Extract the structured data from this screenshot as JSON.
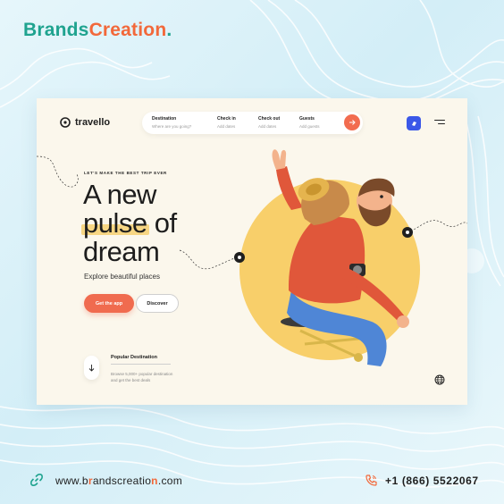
{
  "brand": {
    "part1": "Brands",
    "part2": "Creation",
    "dot": "."
  },
  "app": {
    "logo_text": "travello",
    "search": {
      "fields": [
        {
          "label": "Destination",
          "placeholder": "Where are you going?"
        },
        {
          "label": "Check in",
          "placeholder": "Add dates"
        },
        {
          "label": "Check out",
          "placeholder": "Add dates"
        },
        {
          "label": "Guests",
          "placeholder": "Add guests"
        }
      ]
    },
    "hero": {
      "kicker": "LET'S MAKE THE BEST TRIP EVER",
      "title_line1": "A new",
      "title_highlight": "pulse",
      "title_line2_rest": " of",
      "title_line3": "dream",
      "subtitle": "Explore beautiful places",
      "primary_button": "Get the app",
      "secondary_button": "Discover"
    },
    "popular": {
      "title": "Popular Destination",
      "description": "Browse 5,000+ popular destination and get the best deals"
    }
  },
  "footer": {
    "website_pre": "www.b",
    "website_o1": "r",
    "website_mid": "andscreatio",
    "website_o2": "n",
    "website_post": ".com",
    "phone": "+1 (866) 5522067"
  },
  "colors": {
    "teal": "#1fa38f",
    "orange": "#f2683a",
    "accent_yellow": "#f7d683",
    "app_blue": "#3b58e8"
  }
}
